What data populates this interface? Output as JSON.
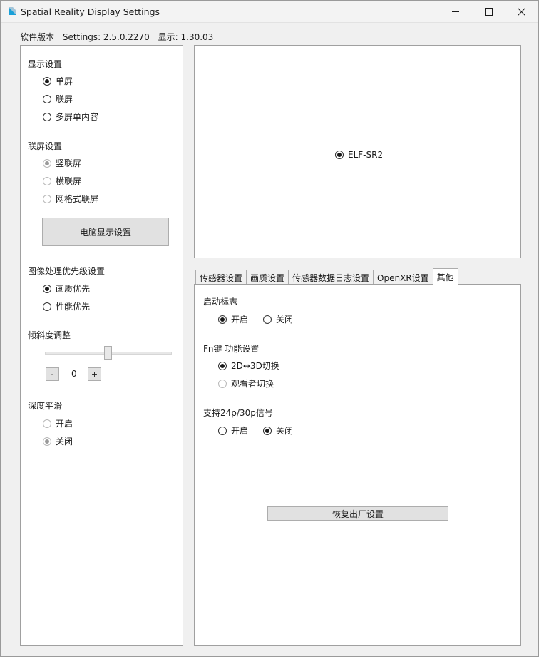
{
  "window": {
    "title": "Spatial Reality Display Settings"
  },
  "version": {
    "software_label": "软件版本",
    "settings": "Settings: 2.5.0.2270",
    "display": "显示: 1.30.03"
  },
  "left": {
    "display_settings": {
      "title": "显示设置",
      "options": [
        {
          "label": "单屏",
          "checked": true,
          "disabled": false
        },
        {
          "label": "联屏",
          "checked": false,
          "disabled": false
        },
        {
          "label": "多屏单内容",
          "checked": false,
          "disabled": false
        }
      ]
    },
    "link_settings": {
      "title": "联屏设置",
      "options": [
        {
          "label": "竖联屏",
          "checked": true,
          "disabled": true
        },
        {
          "label": "横联屏",
          "checked": false,
          "disabled": true
        },
        {
          "label": "网格式联屏",
          "checked": false,
          "disabled": true
        }
      ],
      "button": "电脑显示设置"
    },
    "priority": {
      "title": "图像处理优先级设置",
      "options": [
        {
          "label": "画质优先",
          "checked": true,
          "disabled": false
        },
        {
          "label": "性能优先",
          "checked": false,
          "disabled": false
        }
      ]
    },
    "tilt": {
      "title": "倾斜度调整",
      "value": "0",
      "minus": "-",
      "plus": "+",
      "slider_level": 0.5
    },
    "depth": {
      "title": "深度平滑",
      "options": [
        {
          "label": "开启",
          "checked": false,
          "disabled": true
        },
        {
          "label": "关闭",
          "checked": true,
          "disabled": true
        }
      ]
    }
  },
  "display_list": {
    "device": "ELF-SR2",
    "checked": true
  },
  "tabs": [
    {
      "label": "传感器设置",
      "active": false
    },
    {
      "label": "画质设置",
      "active": false
    },
    {
      "label": "传感器数据日志设置",
      "active": false
    },
    {
      "label": "OpenXR设置",
      "active": false
    },
    {
      "label": "其他",
      "active": true
    }
  ],
  "other": {
    "startup_logo": {
      "title": "启动标志",
      "on": "开启",
      "off": "关闭",
      "selected": "on"
    },
    "fn_key": {
      "title": "Fn键 功能设置",
      "option1": "2D↔3D切换",
      "option2": "观看者切换",
      "selected": "option1"
    },
    "signal": {
      "title": "支持24p/30p信号",
      "on": "开启",
      "off": "关闭",
      "selected": "off"
    },
    "reset_button": "恢复出厂设置"
  }
}
